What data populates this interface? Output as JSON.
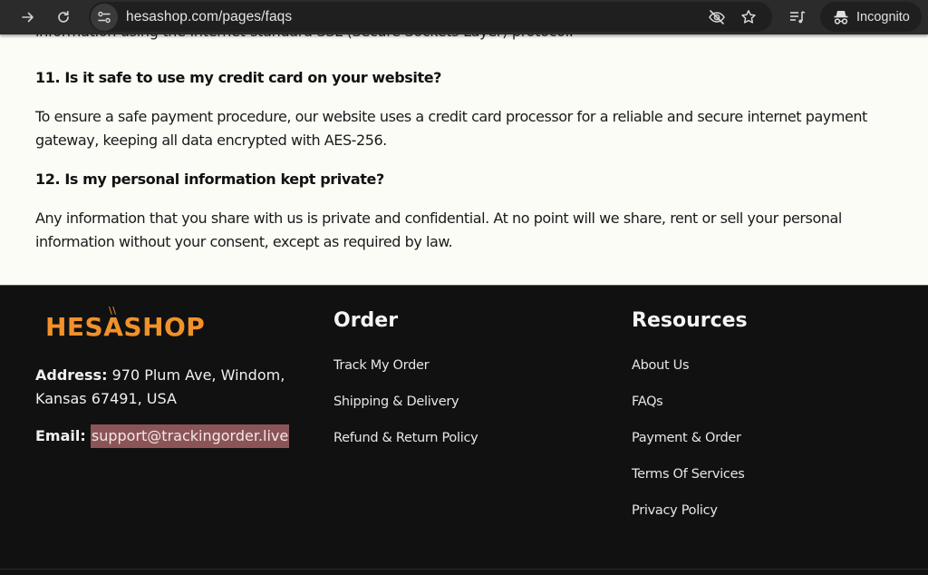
{
  "browser": {
    "url": "hesashop.com/pages/faqs",
    "incognito_label": "Incognito",
    "icons": {
      "forward": "arrow-right",
      "reload": "reload",
      "site_info": "tune-sliders",
      "eye_off": "eye-slash",
      "bookmark": "star",
      "media": "playlist-music",
      "incognito": "incognito-hat-glasses"
    }
  },
  "faq": {
    "cut_line": "information using the Internet-standard SSL (Secure Sockets Layer) protocol.",
    "items": [
      {
        "question": "11. Is it safe to use my credit card on your website?",
        "answer": "To ensure a safe payment procedure, our website uses a credit card processor for a reliable and secure internet payment gateway, keeping all data encrypted with AES-256."
      },
      {
        "question": "12. Is my personal information kept private?",
        "answer": "Any information that you share with us is private and confidential. At no point will we share, rent or sell your personal information without your consent, except as required by law."
      }
    ]
  },
  "footer": {
    "logo_text": "HESASHOP",
    "brand_color": "#f0922b",
    "address_label": "Address:",
    "address_value": "970 Plum Ave, Windom, Kansas 67491, USA",
    "email_label": "Email:",
    "email_value": "support@trackingorder.live",
    "columns": [
      {
        "title": "Order",
        "links": [
          "Track My Order",
          "Shipping & Delivery",
          "Refund & Return Policy"
        ]
      },
      {
        "title": "Resources",
        "links": [
          "About Us",
          "FAQs",
          "Payment & Order",
          "Terms Of Services",
          "Privacy Policy"
        ]
      }
    ]
  }
}
